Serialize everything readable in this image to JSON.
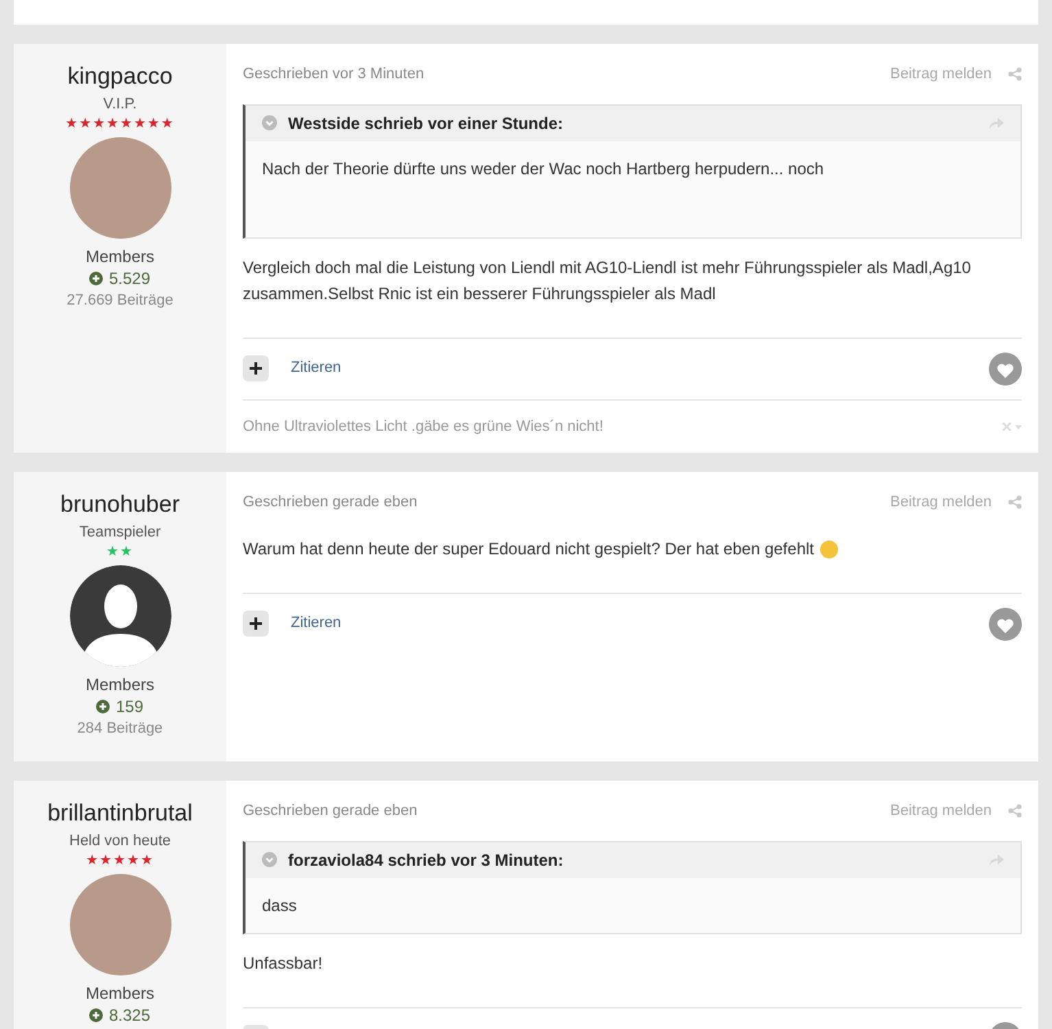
{
  "posts": [
    {
      "author": "kingpacco",
      "rank": "V.I.P.",
      "rank_stars": "★★★★★★★★",
      "color": "#e0222b",
      "avatar": {
        "kind": "photo"
      },
      "group": "Members",
      "reputation": "5.529",
      "post_count": "27.669 Beiträge",
      "timestamp": "Geschrieben vor 3 Minuten",
      "report": "Beitrag melden",
      "quote": {
        "header": "Westside schrieb vor einer Stunde:",
        "text": "Nach der Theorie dürfte uns weder der Wac noch Hartberg herpudern... noch"
      },
      "body": "Vergleich doch mal die Leistung von Liendl mit AG10-Liendl ist mehr Führungsspieler als Madl,Ag10 zusammen.Selbst Rnic ist ein besserer Führungsspieler als Madl",
      "quote_button": "Zitieren",
      "signature": "Ohne Ultraviolettes Licht .gäbe es grüne Wies´n nicht!"
    },
    {
      "author": "brunohuber",
      "rank": "Teamspieler",
      "rank_stars": "★★",
      "color": "#22c55e",
      "avatar": {
        "kind": "silhouette"
      },
      "group": "Members",
      "reputation": "159",
      "post_count": "284 Beiträge",
      "timestamp": "Geschrieben gerade eben",
      "report": "Beitrag melden",
      "body": "Warum hat denn heute der super Edouard nicht gespielt? Der hat eben gefehlt",
      "emoji": true,
      "quote_button": "Zitieren"
    },
    {
      "author": "brillantinbrutal",
      "rank": "Held von heute",
      "rank_stars": "★★★★★",
      "color": "#e0222b",
      "avatar": {
        "kind": "photo"
      },
      "group": "Members",
      "reputation": "8.325",
      "timestamp": "Geschrieben gerade eben",
      "report": "Beitrag melden",
      "quote": {
        "header": "forzaviola84 schrieb vor 3 Minuten:",
        "text": "dass"
      },
      "body": "Unfassbar!"
    }
  ]
}
